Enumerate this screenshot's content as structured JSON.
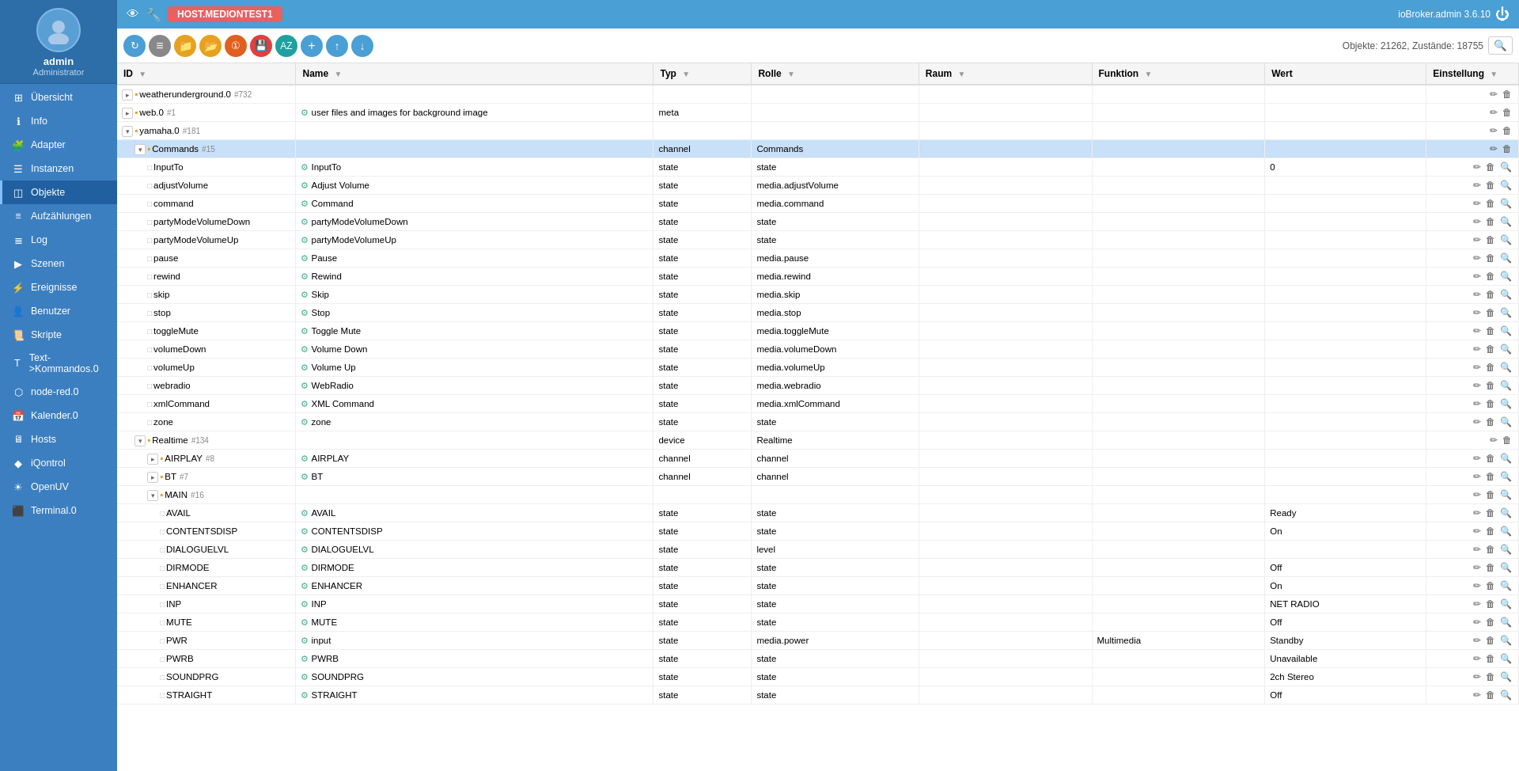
{
  "app": {
    "title": "ioBroker.admin 3.6.10",
    "host_label": "HOST.MEDIONTEST1",
    "stats": "Objekte: 21262, Zustände: 18755"
  },
  "sidebar": {
    "username": "admin",
    "role": "Administrator",
    "items": [
      {
        "id": "uebersicht",
        "label": "Übersicht",
        "icon": "grid"
      },
      {
        "id": "info",
        "label": "Info",
        "icon": "info"
      },
      {
        "id": "adapter",
        "label": "Adapter",
        "icon": "puzzle"
      },
      {
        "id": "instanzen",
        "label": "Instanzen",
        "icon": "list"
      },
      {
        "id": "objekte",
        "label": "Objekte",
        "icon": "layers",
        "active": true
      },
      {
        "id": "aufzaehlungen",
        "label": "Aufzählungen",
        "icon": "enum"
      },
      {
        "id": "log",
        "label": "Log",
        "icon": "log"
      },
      {
        "id": "szenen",
        "label": "Szenen",
        "icon": "scene"
      },
      {
        "id": "ereignisse",
        "label": "Ereignisse",
        "icon": "events"
      },
      {
        "id": "benutzer",
        "label": "Benutzer",
        "icon": "user"
      },
      {
        "id": "skripte",
        "label": "Skripte",
        "icon": "script"
      },
      {
        "id": "text-kommandos",
        "label": "Text->Kommandos.0",
        "icon": "text"
      },
      {
        "id": "node-red",
        "label": "node-red.0",
        "icon": "node"
      },
      {
        "id": "kalender",
        "label": "Kalender.0",
        "icon": "calendar"
      },
      {
        "id": "hosts",
        "label": "Hosts",
        "icon": "host"
      },
      {
        "id": "iqontrol",
        "label": "iQontrol",
        "icon": "iq"
      },
      {
        "id": "openuv",
        "label": "OpenUV",
        "icon": "uv"
      },
      {
        "id": "terminal",
        "label": "Terminal.0",
        "icon": "terminal"
      }
    ]
  },
  "toolbar": {
    "buttons": [
      {
        "id": "refresh",
        "label": "↻",
        "color": "btn-blue"
      },
      {
        "id": "menu",
        "label": "≡",
        "color": "btn-gray"
      },
      {
        "id": "folder",
        "label": "📁",
        "color": "btn-yellow"
      },
      {
        "id": "folder2",
        "label": "📂",
        "color": "btn-yellow"
      },
      {
        "id": "badge1",
        "label": "①",
        "color": "btn-orange"
      },
      {
        "id": "save",
        "label": "💾",
        "color": "btn-red"
      },
      {
        "id": "export",
        "label": "AZ",
        "color": "btn-teal"
      },
      {
        "id": "add",
        "label": "+",
        "color": "btn-blue"
      },
      {
        "id": "upload",
        "label": "↑",
        "color": "btn-blue"
      },
      {
        "id": "download",
        "label": "↓",
        "color": "btn-blue"
      }
    ],
    "stats": "Objekte: 21262, Zustände: 18755"
  },
  "table": {
    "columns": [
      {
        "id": "id",
        "label": "ID"
      },
      {
        "id": "name",
        "label": "Name"
      },
      {
        "id": "typ",
        "label": "Typ"
      },
      {
        "id": "rolle",
        "label": "Rolle"
      },
      {
        "id": "raum",
        "label": "Raum"
      },
      {
        "id": "funktion",
        "label": "Funktion"
      },
      {
        "id": "wert",
        "label": "Wert"
      },
      {
        "id": "einstellung",
        "label": "Einstellung"
      }
    ],
    "rows": [
      {
        "level": 1,
        "expandable": true,
        "expanded": false,
        "type": "folder",
        "id": "weatherunderground.0",
        "badge": "#732",
        "name": "",
        "typ": "",
        "rolle": "",
        "raum": "",
        "funktion": "",
        "wert": "",
        "selected": false
      },
      {
        "level": 1,
        "expandable": true,
        "expanded": false,
        "type": "folder",
        "id": "web.0",
        "badge": "#1",
        "name": "user files and images for background image",
        "typ": "meta",
        "rolle": "",
        "raum": "",
        "funktion": "",
        "wert": "",
        "selected": false
      },
      {
        "level": 1,
        "expandable": true,
        "expanded": true,
        "type": "folder",
        "id": "yamaha.0",
        "badge": "#181",
        "name": "",
        "typ": "",
        "rolle": "",
        "raum": "",
        "funktion": "",
        "wert": "",
        "selected": false
      },
      {
        "level": 2,
        "expandable": true,
        "expanded": true,
        "type": "folder",
        "id": "Commands",
        "badge": "#15",
        "name": "",
        "typ": "channel",
        "rolle": "Commands",
        "raum": "",
        "funktion": "",
        "wert": "",
        "selected": true
      },
      {
        "level": 3,
        "expandable": false,
        "type": "file",
        "id": "InputTo",
        "badge": "",
        "name": "InputTo",
        "typ": "state",
        "rolle": "state",
        "raum": "",
        "funktion": "",
        "wert": "0",
        "selected": false
      },
      {
        "level": 3,
        "expandable": false,
        "type": "file",
        "id": "adjustVolume",
        "badge": "",
        "name": "Adjust Volume",
        "typ": "state",
        "rolle": "media.adjustVolume",
        "raum": "",
        "funktion": "",
        "wert": "",
        "selected": false
      },
      {
        "level": 3,
        "expandable": false,
        "type": "file",
        "id": "command",
        "badge": "",
        "name": "Command",
        "typ": "state",
        "rolle": "media.command",
        "raum": "",
        "funktion": "",
        "wert": "",
        "selected": false
      },
      {
        "level": 3,
        "expandable": false,
        "type": "file",
        "id": "partyModeVolumeDown",
        "badge": "",
        "name": "partyModeVolumeDown",
        "typ": "state",
        "rolle": "state",
        "raum": "",
        "funktion": "",
        "wert": "",
        "selected": false
      },
      {
        "level": 3,
        "expandable": false,
        "type": "file",
        "id": "partyModeVolumeUp",
        "badge": "",
        "name": "partyModeVolumeUp",
        "typ": "state",
        "rolle": "state",
        "raum": "",
        "funktion": "",
        "wert": "",
        "selected": false
      },
      {
        "level": 3,
        "expandable": false,
        "type": "file",
        "id": "pause",
        "badge": "",
        "name": "Pause",
        "typ": "state",
        "rolle": "media.pause",
        "raum": "",
        "funktion": "",
        "wert": "",
        "selected": false
      },
      {
        "level": 3,
        "expandable": false,
        "type": "file",
        "id": "rewind",
        "badge": "",
        "name": "Rewind",
        "typ": "state",
        "rolle": "media.rewind",
        "raum": "",
        "funktion": "",
        "wert": "",
        "selected": false
      },
      {
        "level": 3,
        "expandable": false,
        "type": "file",
        "id": "skip",
        "badge": "",
        "name": "Skip",
        "typ": "state",
        "rolle": "media.skip",
        "raum": "",
        "funktion": "",
        "wert": "",
        "selected": false
      },
      {
        "level": 3,
        "expandable": false,
        "type": "file",
        "id": "stop",
        "badge": "",
        "name": "Stop",
        "typ": "state",
        "rolle": "media.stop",
        "raum": "",
        "funktion": "",
        "wert": "",
        "selected": false
      },
      {
        "level": 3,
        "expandable": false,
        "type": "file",
        "id": "toggleMute",
        "badge": "",
        "name": "Toggle Mute",
        "typ": "state",
        "rolle": "media.toggleMute",
        "raum": "",
        "funktion": "",
        "wert": "",
        "selected": false
      },
      {
        "level": 3,
        "expandable": false,
        "type": "file",
        "id": "volumeDown",
        "badge": "",
        "name": "Volume Down",
        "typ": "state",
        "rolle": "media.volumeDown",
        "raum": "",
        "funktion": "",
        "wert": "",
        "selected": false
      },
      {
        "level": 3,
        "expandable": false,
        "type": "file",
        "id": "volumeUp",
        "badge": "",
        "name": "Volume Up",
        "typ": "state",
        "rolle": "media.volumeUp",
        "raum": "",
        "funktion": "",
        "wert": "",
        "selected": false
      },
      {
        "level": 3,
        "expandable": false,
        "type": "file",
        "id": "webradio",
        "badge": "",
        "name": "WebRadio",
        "typ": "state",
        "rolle": "media.webradio",
        "raum": "",
        "funktion": "",
        "wert": "",
        "selected": false
      },
      {
        "level": 3,
        "expandable": false,
        "type": "file",
        "id": "xmlCommand",
        "badge": "",
        "name": "XML Command",
        "typ": "state",
        "rolle": "media.xmlCommand",
        "raum": "",
        "funktion": "",
        "wert": "",
        "selected": false
      },
      {
        "level": 3,
        "expandable": false,
        "type": "file",
        "id": "zone",
        "badge": "",
        "name": "zone",
        "typ": "state",
        "rolle": "state",
        "raum": "",
        "funktion": "",
        "wert": "",
        "selected": false
      },
      {
        "level": 2,
        "expandable": true,
        "expanded": true,
        "type": "folder",
        "id": "Realtime",
        "badge": "#134",
        "name": "",
        "typ": "device",
        "rolle": "Realtime",
        "raum": "",
        "funktion": "",
        "wert": "",
        "selected": false
      },
      {
        "level": 3,
        "expandable": true,
        "expanded": false,
        "type": "folder",
        "id": "AIRPLAY",
        "badge": "#8",
        "name": "AIRPLAY",
        "typ": "channel",
        "rolle": "channel",
        "raum": "",
        "funktion": "",
        "wert": "",
        "selected": false
      },
      {
        "level": 3,
        "expandable": true,
        "expanded": false,
        "type": "folder",
        "id": "BT",
        "badge": "#7",
        "name": "BT",
        "typ": "channel",
        "rolle": "channel",
        "raum": "",
        "funktion": "",
        "wert": "",
        "selected": false
      },
      {
        "level": 3,
        "expandable": true,
        "expanded": true,
        "type": "folder",
        "id": "MAIN",
        "badge": "#16",
        "name": "",
        "typ": "",
        "rolle": "",
        "raum": "",
        "funktion": "",
        "wert": "",
        "selected": false
      },
      {
        "level": 4,
        "expandable": false,
        "type": "file",
        "id": "AVAIL",
        "badge": "",
        "name": "AVAIL",
        "typ": "state",
        "rolle": "state",
        "raum": "",
        "funktion": "",
        "wert": "Ready",
        "selected": false
      },
      {
        "level": 4,
        "expandable": false,
        "type": "file",
        "id": "CONTENTSDISP",
        "badge": "",
        "name": "CONTENTSDISP",
        "typ": "state",
        "rolle": "state",
        "raum": "",
        "funktion": "",
        "wert": "On",
        "selected": false
      },
      {
        "level": 4,
        "expandable": false,
        "type": "file",
        "id": "DIALOGUELVL",
        "badge": "",
        "name": "DIALOGUELVL",
        "typ": "state",
        "rolle": "level",
        "raum": "",
        "funktion": "",
        "wert": "",
        "selected": false
      },
      {
        "level": 4,
        "expandable": false,
        "type": "file",
        "id": "DIRMODE",
        "badge": "",
        "name": "DIRMODE",
        "typ": "state",
        "rolle": "state",
        "raum": "",
        "funktion": "",
        "wert": "Off",
        "selected": false
      },
      {
        "level": 4,
        "expandable": false,
        "type": "file",
        "id": "ENHANCER",
        "badge": "",
        "name": "ENHANCER",
        "typ": "state",
        "rolle": "state",
        "raum": "",
        "funktion": "",
        "wert": "On",
        "selected": false
      },
      {
        "level": 4,
        "expandable": false,
        "type": "file",
        "id": "INP",
        "badge": "",
        "name": "INP",
        "typ": "state",
        "rolle": "state",
        "raum": "",
        "funktion": "",
        "wert": "NET RADIO",
        "selected": false
      },
      {
        "level": 4,
        "expandable": false,
        "type": "file",
        "id": "MUTE",
        "badge": "",
        "name": "MUTE",
        "typ": "state",
        "rolle": "state",
        "raum": "",
        "funktion": "",
        "wert": "Off",
        "selected": false
      },
      {
        "level": 4,
        "expandable": false,
        "type": "file",
        "id": "PWR",
        "badge": "",
        "name": "input",
        "typ": "state",
        "rolle": "media.power",
        "raum": "",
        "funktion": "Multimedia",
        "wert": "Standby",
        "selected": false
      },
      {
        "level": 4,
        "expandable": false,
        "type": "file",
        "id": "PWRB",
        "badge": "",
        "name": "PWRB",
        "typ": "state",
        "rolle": "state",
        "raum": "",
        "funktion": "",
        "wert": "Unavailable",
        "selected": false
      },
      {
        "level": 4,
        "expandable": false,
        "type": "file",
        "id": "SOUNDPRG",
        "badge": "",
        "name": "SOUNDPRG",
        "typ": "state",
        "rolle": "state",
        "raum": "",
        "funktion": "",
        "wert": "2ch Stereo",
        "selected": false
      },
      {
        "level": 4,
        "expandable": false,
        "type": "file",
        "id": "STRAIGHT",
        "badge": "",
        "name": "STRAIGHT",
        "typ": "state",
        "rolle": "state",
        "raum": "",
        "funktion": "",
        "wert": "Off",
        "selected": false
      }
    ]
  },
  "icons": {
    "info_circle": "ℹ",
    "grid": "⊞",
    "puzzle": "🧩",
    "list": "☰",
    "layers": "◫",
    "enum": "≡",
    "log": "📋",
    "scene": "🎭",
    "events": "⚡",
    "user": "👤",
    "script": "📜",
    "text": "T→",
    "node": "⬡",
    "calendar": "📅",
    "host": "🖥",
    "iq": "🔷",
    "uv": "☀",
    "terminal": "⬛",
    "pencil": "✏",
    "trash": "🗑",
    "zoom": "🔍"
  }
}
